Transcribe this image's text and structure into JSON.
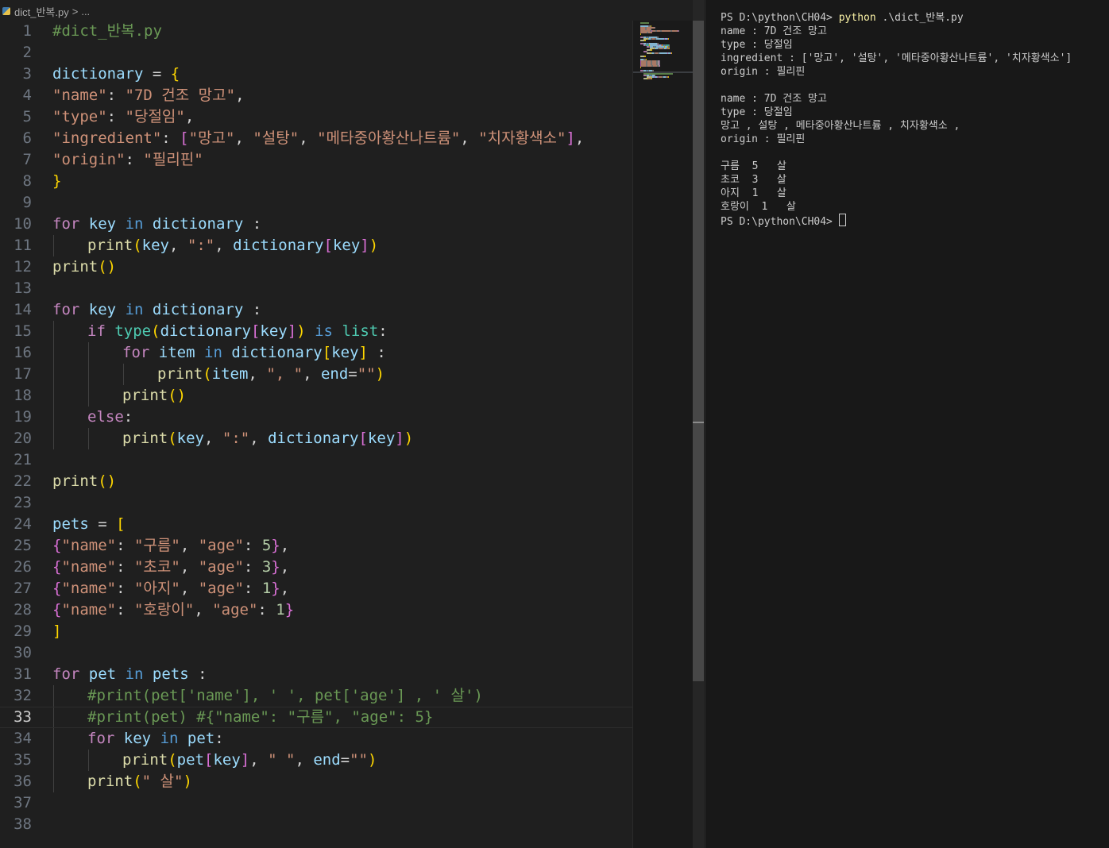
{
  "breadcrumb": {
    "file": "dict_반복.py",
    "separator": ">",
    "more": "..."
  },
  "editor": {
    "current_line": 33,
    "lines": [
      {
        "n": "1",
        "indent": 0,
        "tokens": [
          [
            "#dict_반복.py",
            "c"
          ]
        ]
      },
      {
        "n": "2",
        "indent": 0,
        "tokens": []
      },
      {
        "n": "3",
        "indent": 0,
        "tokens": [
          [
            "dictionary",
            "v"
          ],
          [
            " = ",
            "p"
          ],
          [
            "{",
            "b1"
          ]
        ]
      },
      {
        "n": "4",
        "indent": 0,
        "tokens": [
          [
            "\"name\"",
            "s"
          ],
          [
            ": ",
            "p"
          ],
          [
            "\"7D 건조 망고\"",
            "s"
          ],
          [
            ",",
            "p"
          ]
        ]
      },
      {
        "n": "5",
        "indent": 0,
        "tokens": [
          [
            "\"type\"",
            "s"
          ],
          [
            ": ",
            "p"
          ],
          [
            "\"당절임\"",
            "s"
          ],
          [
            ",",
            "p"
          ]
        ]
      },
      {
        "n": "6",
        "indent": 0,
        "tokens": [
          [
            "\"ingredient\"",
            "s"
          ],
          [
            ": ",
            "p"
          ],
          [
            "[",
            "b2"
          ],
          [
            "\"망고\"",
            "s"
          ],
          [
            ", ",
            "p"
          ],
          [
            "\"설탕\"",
            "s"
          ],
          [
            ", ",
            "p"
          ],
          [
            "\"메타중아황산나트륨\"",
            "s"
          ],
          [
            ", ",
            "p"
          ],
          [
            "\"치자황색소\"",
            "s"
          ],
          [
            "]",
            "b2"
          ],
          [
            ",",
            "p"
          ]
        ]
      },
      {
        "n": "7",
        "indent": 0,
        "tokens": [
          [
            "\"origin\"",
            "s"
          ],
          [
            ": ",
            "p"
          ],
          [
            "\"필리핀\"",
            "s"
          ]
        ]
      },
      {
        "n": "8",
        "indent": 0,
        "tokens": [
          [
            "}",
            "b1"
          ]
        ]
      },
      {
        "n": "9",
        "indent": 0,
        "tokens": []
      },
      {
        "n": "10",
        "indent": 0,
        "tokens": [
          [
            "for",
            "ct"
          ],
          [
            " ",
            "p"
          ],
          [
            "key",
            "v"
          ],
          [
            " ",
            "p"
          ],
          [
            "in",
            "k"
          ],
          [
            " ",
            "p"
          ],
          [
            "dictionary",
            "v"
          ],
          [
            " :",
            "p"
          ]
        ]
      },
      {
        "n": "11",
        "indent": 1,
        "tokens": [
          [
            "print",
            "f"
          ],
          [
            "(",
            "b1"
          ],
          [
            "key",
            "v"
          ],
          [
            ", ",
            "p"
          ],
          [
            "\":\"",
            "s"
          ],
          [
            ", ",
            "p"
          ],
          [
            "dictionary",
            "v"
          ],
          [
            "[",
            "b2"
          ],
          [
            "key",
            "v"
          ],
          [
            "]",
            "b2"
          ],
          [
            ")",
            "b1"
          ]
        ]
      },
      {
        "n": "12",
        "indent": 0,
        "tokens": [
          [
            "print",
            "f"
          ],
          [
            "()",
            "b1"
          ]
        ]
      },
      {
        "n": "13",
        "indent": 0,
        "tokens": []
      },
      {
        "n": "14",
        "indent": 0,
        "tokens": [
          [
            "for",
            "ct"
          ],
          [
            " ",
            "p"
          ],
          [
            "key",
            "v"
          ],
          [
            " ",
            "p"
          ],
          [
            "in",
            "k"
          ],
          [
            " ",
            "p"
          ],
          [
            "dictionary",
            "v"
          ],
          [
            " :",
            "p"
          ]
        ]
      },
      {
        "n": "15",
        "indent": 1,
        "tokens": [
          [
            "if",
            "ct"
          ],
          [
            " ",
            "p"
          ],
          [
            "type",
            "t"
          ],
          [
            "(",
            "b1"
          ],
          [
            "dictionary",
            "v"
          ],
          [
            "[",
            "b2"
          ],
          [
            "key",
            "v"
          ],
          [
            "]",
            "b2"
          ],
          [
            ")",
            "b1"
          ],
          [
            " ",
            "p"
          ],
          [
            "is",
            "k"
          ],
          [
            " ",
            "p"
          ],
          [
            "list",
            "t"
          ],
          [
            ":",
            "p"
          ]
        ]
      },
      {
        "n": "16",
        "indent": 2,
        "tokens": [
          [
            "for",
            "ct"
          ],
          [
            " ",
            "p"
          ],
          [
            "item",
            "v"
          ],
          [
            " ",
            "p"
          ],
          [
            "in",
            "k"
          ],
          [
            " ",
            "p"
          ],
          [
            "dictionary",
            "v"
          ],
          [
            "[",
            "b1"
          ],
          [
            "key",
            "v"
          ],
          [
            "]",
            "b1"
          ],
          [
            " :",
            "p"
          ]
        ]
      },
      {
        "n": "17",
        "indent": 3,
        "tokens": [
          [
            "print",
            "f"
          ],
          [
            "(",
            "b1"
          ],
          [
            "item",
            "v"
          ],
          [
            ", ",
            "p"
          ],
          [
            "\", \"",
            "s"
          ],
          [
            ", ",
            "p"
          ],
          [
            "end",
            "v"
          ],
          [
            "=",
            "p"
          ],
          [
            "\"\"",
            "s"
          ],
          [
            ")",
            "b1"
          ]
        ]
      },
      {
        "n": "18",
        "indent": 2,
        "tokens": [
          [
            "print",
            "f"
          ],
          [
            "()",
            "b1"
          ]
        ]
      },
      {
        "n": "19",
        "indent": 1,
        "tokens": [
          [
            "else",
            "ct"
          ],
          [
            ":",
            "p"
          ]
        ]
      },
      {
        "n": "20",
        "indent": 2,
        "tokens": [
          [
            "print",
            "f"
          ],
          [
            "(",
            "b1"
          ],
          [
            "key",
            "v"
          ],
          [
            ", ",
            "p"
          ],
          [
            "\":\"",
            "s"
          ],
          [
            ", ",
            "p"
          ],
          [
            "dictionary",
            "v"
          ],
          [
            "[",
            "b2"
          ],
          [
            "key",
            "v"
          ],
          [
            "]",
            "b2"
          ],
          [
            ")",
            "b1"
          ]
        ]
      },
      {
        "n": "21",
        "indent": 0,
        "tokens": []
      },
      {
        "n": "22",
        "indent": 0,
        "tokens": [
          [
            "print",
            "f"
          ],
          [
            "()",
            "b1"
          ]
        ]
      },
      {
        "n": "23",
        "indent": 0,
        "tokens": []
      },
      {
        "n": "24",
        "indent": 0,
        "tokens": [
          [
            "pets",
            "v"
          ],
          [
            " = ",
            "p"
          ],
          [
            "[",
            "b1"
          ]
        ]
      },
      {
        "n": "25",
        "indent": 0,
        "tokens": [
          [
            "{",
            "b2"
          ],
          [
            "\"name\"",
            "s"
          ],
          [
            ": ",
            "p"
          ],
          [
            "\"구름\"",
            "s"
          ],
          [
            ", ",
            "p"
          ],
          [
            "\"age\"",
            "s"
          ],
          [
            ": ",
            "p"
          ],
          [
            "5",
            "n"
          ],
          [
            "}",
            "b2"
          ],
          [
            ",",
            "p"
          ]
        ]
      },
      {
        "n": "26",
        "indent": 0,
        "tokens": [
          [
            "{",
            "b2"
          ],
          [
            "\"name\"",
            "s"
          ],
          [
            ": ",
            "p"
          ],
          [
            "\"초코\"",
            "s"
          ],
          [
            ", ",
            "p"
          ],
          [
            "\"age\"",
            "s"
          ],
          [
            ": ",
            "p"
          ],
          [
            "3",
            "n"
          ],
          [
            "}",
            "b2"
          ],
          [
            ",",
            "p"
          ]
        ]
      },
      {
        "n": "27",
        "indent": 0,
        "tokens": [
          [
            "{",
            "b2"
          ],
          [
            "\"name\"",
            "s"
          ],
          [
            ": ",
            "p"
          ],
          [
            "\"아지\"",
            "s"
          ],
          [
            ", ",
            "p"
          ],
          [
            "\"age\"",
            "s"
          ],
          [
            ": ",
            "p"
          ],
          [
            "1",
            "n"
          ],
          [
            "}",
            "b2"
          ],
          [
            ",",
            "p"
          ]
        ]
      },
      {
        "n": "28",
        "indent": 0,
        "tokens": [
          [
            "{",
            "b2"
          ],
          [
            "\"name\"",
            "s"
          ],
          [
            ": ",
            "p"
          ],
          [
            "\"호랑이\"",
            "s"
          ],
          [
            ", ",
            "p"
          ],
          [
            "\"age\"",
            "s"
          ],
          [
            ": ",
            "p"
          ],
          [
            "1",
            "n"
          ],
          [
            "}",
            "b2"
          ]
        ]
      },
      {
        "n": "29",
        "indent": 0,
        "tokens": [
          [
            "]",
            "b1"
          ]
        ]
      },
      {
        "n": "30",
        "indent": 0,
        "tokens": []
      },
      {
        "n": "31",
        "indent": 0,
        "tokens": [
          [
            "for",
            "ct"
          ],
          [
            " ",
            "p"
          ],
          [
            "pet",
            "v"
          ],
          [
            " ",
            "p"
          ],
          [
            "in",
            "k"
          ],
          [
            " ",
            "p"
          ],
          [
            "pets",
            "v"
          ],
          [
            " :",
            "p"
          ]
        ]
      },
      {
        "n": "32",
        "indent": 1,
        "tokens": [
          [
            "#print(pet['name'], ' ', pet['age'] , ' 살')",
            "c"
          ]
        ]
      },
      {
        "n": "33",
        "indent": 1,
        "tokens": [
          [
            "#print(pet) #{\"name\": \"구름\", \"age\": 5}",
            "c"
          ]
        ]
      },
      {
        "n": "34",
        "indent": 1,
        "tokens": [
          [
            "for",
            "ct"
          ],
          [
            " ",
            "p"
          ],
          [
            "key",
            "v"
          ],
          [
            " ",
            "p"
          ],
          [
            "in",
            "k"
          ],
          [
            " ",
            "p"
          ],
          [
            "pet",
            "v"
          ],
          [
            ":",
            "p"
          ]
        ]
      },
      {
        "n": "35",
        "indent": 2,
        "tokens": [
          [
            "print",
            "f"
          ],
          [
            "(",
            "b1"
          ],
          [
            "pet",
            "v"
          ],
          [
            "[",
            "b2"
          ],
          [
            "key",
            "v"
          ],
          [
            "]",
            "b2"
          ],
          [
            ", ",
            "p"
          ],
          [
            "\" \"",
            "s"
          ],
          [
            ", ",
            "p"
          ],
          [
            "end",
            "v"
          ],
          [
            "=",
            "p"
          ],
          [
            "\"\"",
            "s"
          ],
          [
            ")",
            "b1"
          ]
        ]
      },
      {
        "n": "36",
        "indent": 1,
        "tokens": [
          [
            "print",
            "f"
          ],
          [
            "(",
            "b1"
          ],
          [
            "\" 살\"",
            "s"
          ],
          [
            ")",
            "b1"
          ]
        ]
      },
      {
        "n": "37",
        "indent": 0,
        "tokens": []
      },
      {
        "n": "38",
        "indent": 0,
        "tokens": []
      }
    ]
  },
  "terminal": {
    "prompt": "PS D:\\python\\CH04> ",
    "command": "python",
    "command_args": " .\\dict_반복.py",
    "output_lines": [
      "name : 7D 건조 망고",
      "type : 당절임",
      "ingredient : ['망고', '설탕', '메타중아황산나트륨', '치자황색소']",
      "origin : 필리핀",
      "",
      "name : 7D 건조 망고",
      "type : 당절임",
      "망고 , 설탕 , 메타중아황산나트륨 , 치자황색소 ,",
      "origin : 필리핀",
      "",
      "구름  5   살",
      "초코  3   살",
      "아지  1   살",
      "호랑이  1   살"
    ],
    "final_prompt": "PS D:\\python\\CH04> "
  }
}
